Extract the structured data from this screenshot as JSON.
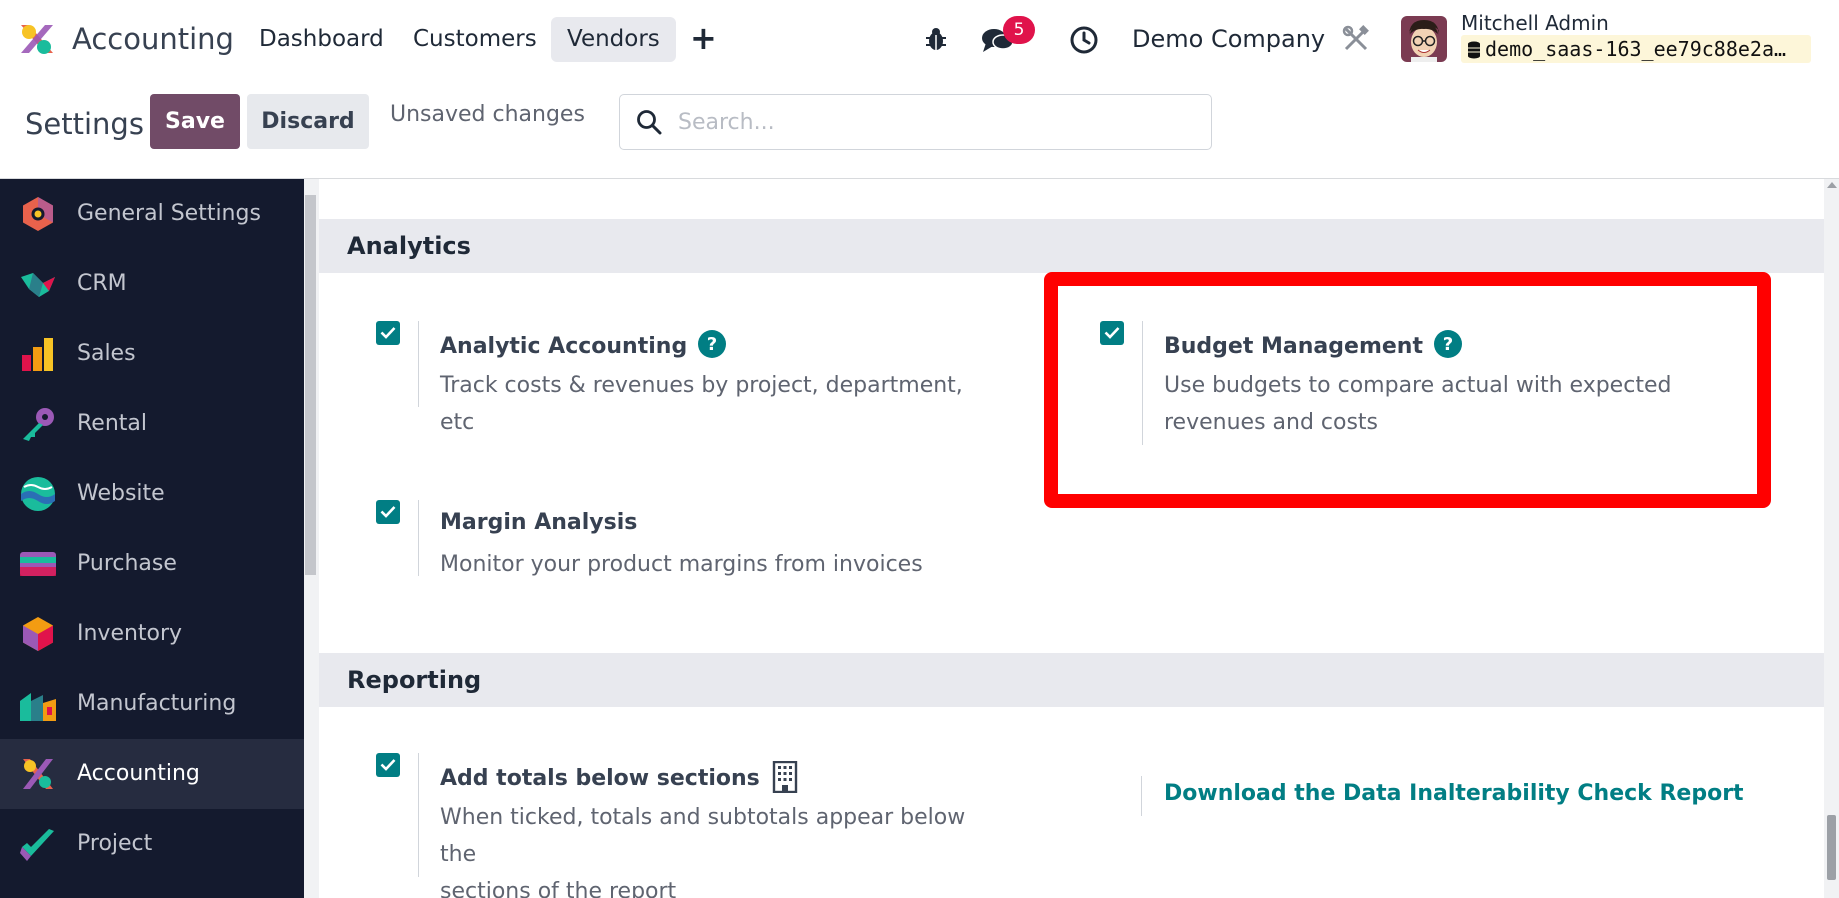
{
  "topnav": {
    "app_name": "Accounting",
    "menus": [
      "Dashboard",
      "Customers",
      "Vendors"
    ],
    "active_menu": "Vendors",
    "plus_label": "+",
    "messages_count": "5",
    "company": "Demo Company",
    "user_name": "Mitchell Admin",
    "database": "demo_saas-163_ee79c88e2a…"
  },
  "control_panel": {
    "title": "Settings",
    "save_label": "Save",
    "discard_label": "Discard",
    "unsaved_label": "Unsaved changes",
    "search_placeholder": "Search..."
  },
  "sidebar": {
    "items": [
      {
        "label": "General Settings",
        "icon": "general-settings-icon"
      },
      {
        "label": "CRM",
        "icon": "crm-icon"
      },
      {
        "label": "Sales",
        "icon": "sales-icon"
      },
      {
        "label": "Rental",
        "icon": "rental-icon"
      },
      {
        "label": "Website",
        "icon": "website-icon"
      },
      {
        "label": "Purchase",
        "icon": "purchase-icon"
      },
      {
        "label": "Inventory",
        "icon": "inventory-icon"
      },
      {
        "label": "Manufacturing",
        "icon": "manufacturing-icon"
      },
      {
        "label": "Accounting",
        "icon": "accounting-icon"
      },
      {
        "label": "Project",
        "icon": "project-icon"
      }
    ],
    "active_item": "Accounting"
  },
  "sections": {
    "analytics": {
      "title": "Analytics",
      "analytic_accounting": {
        "title": "Analytic Accounting",
        "desc": "Track costs & revenues by project, department, etc",
        "checked": true
      },
      "budget_management": {
        "title": "Budget Management",
        "desc_line1": "Use budgets to compare actual with expected",
        "desc_line2": "revenues and costs",
        "checked": true
      },
      "margin_analysis": {
        "title": "Margin Analysis",
        "desc": "Monitor your product margins from invoices",
        "checked": true
      }
    },
    "reporting": {
      "title": "Reporting",
      "add_totals": {
        "title": "Add totals below sections",
        "desc_line1": "When ticked, totals and subtotals appear below the",
        "desc_line2": "sections of the report",
        "checked": true
      },
      "download_link": "Download the Data Inalterability Check Report"
    }
  },
  "colors": {
    "brand": "#714b67",
    "accent": "#017e84",
    "sidebar_bg": "#141a2e",
    "badge": "#e0134b",
    "highlight": "#ff0000"
  }
}
